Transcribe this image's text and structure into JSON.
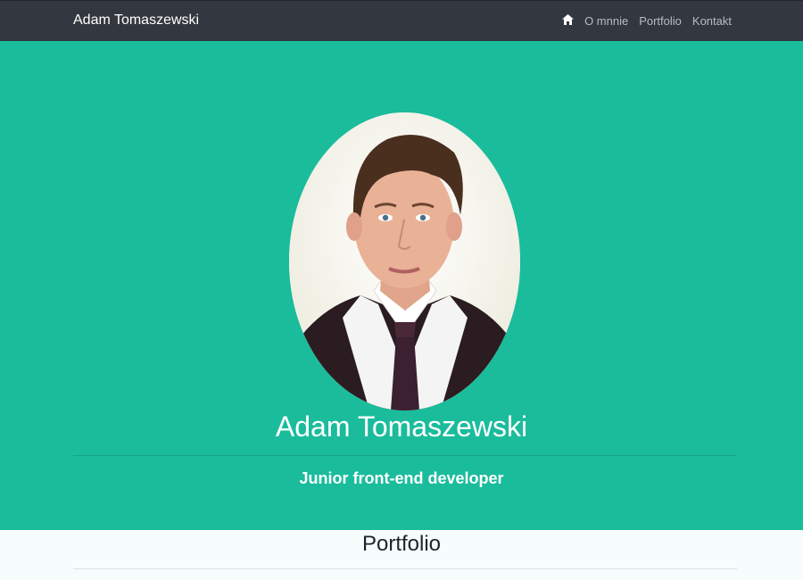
{
  "navbar": {
    "brand": "Adam Tomaszewski",
    "home_icon": "home-icon",
    "links": [
      "O mnnie",
      "Portfolio",
      "Kontakt"
    ]
  },
  "hero": {
    "name": "Adam Tomaszewski",
    "subtitle": "Junior front-end developer",
    "background_color": "#1abc9c"
  },
  "portfolio": {
    "title": "Portfolio"
  }
}
